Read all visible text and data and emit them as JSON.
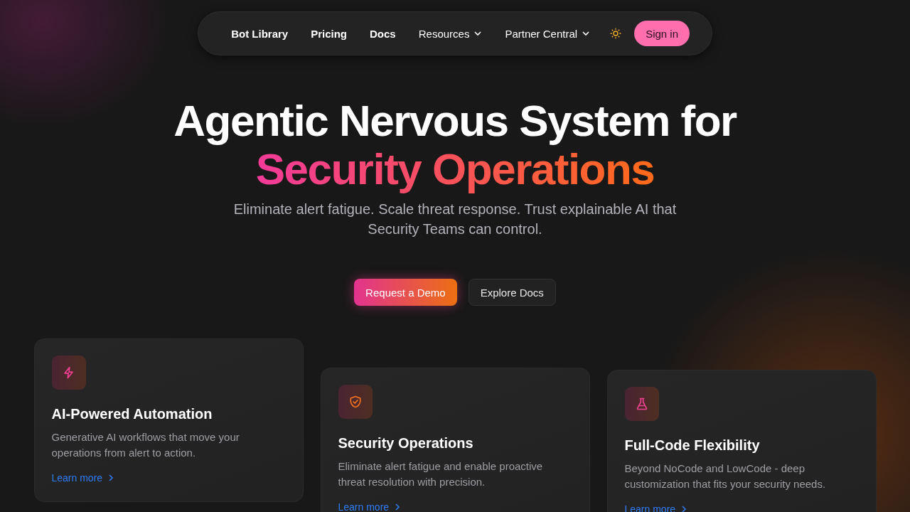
{
  "nav": {
    "items": [
      {
        "label": "Bot Library",
        "kind": "link"
      },
      {
        "label": "Pricing",
        "kind": "link"
      },
      {
        "label": "Docs",
        "kind": "link"
      },
      {
        "label": "Resources",
        "kind": "dropdown"
      },
      {
        "label": "Partner Central",
        "kind": "dropdown"
      }
    ],
    "sign_in": "Sign in"
  },
  "hero": {
    "title_line": "Agentic Nervous System for",
    "highlight": "Security Operations",
    "subtitle": "Eliminate alert fatigue. Scale threat response. Trust explainable AI that Security Teams can control.",
    "buttons": [
      {
        "label": "Request a Demo",
        "kind": "primary"
      },
      {
        "label": "Explore Docs",
        "kind": "secondary"
      }
    ]
  },
  "features": [
    {
      "kind": "bolt",
      "title": "AI-Powered Automation",
      "description": "Generative AI workflows that move your operations from alert to action.",
      "link": "Learn more"
    },
    {
      "kind": "shield",
      "title": "Security Operations",
      "description": "Eliminate alert fatigue and enable proactive threat resolution with precision.",
      "link": "Learn more"
    },
    {
      "kind": "flask",
      "title": "Full-Code Flexibility",
      "description": "Beyond NoCode and LowCode - deep customization that fits your security needs.",
      "link": "Learn more"
    }
  ]
}
